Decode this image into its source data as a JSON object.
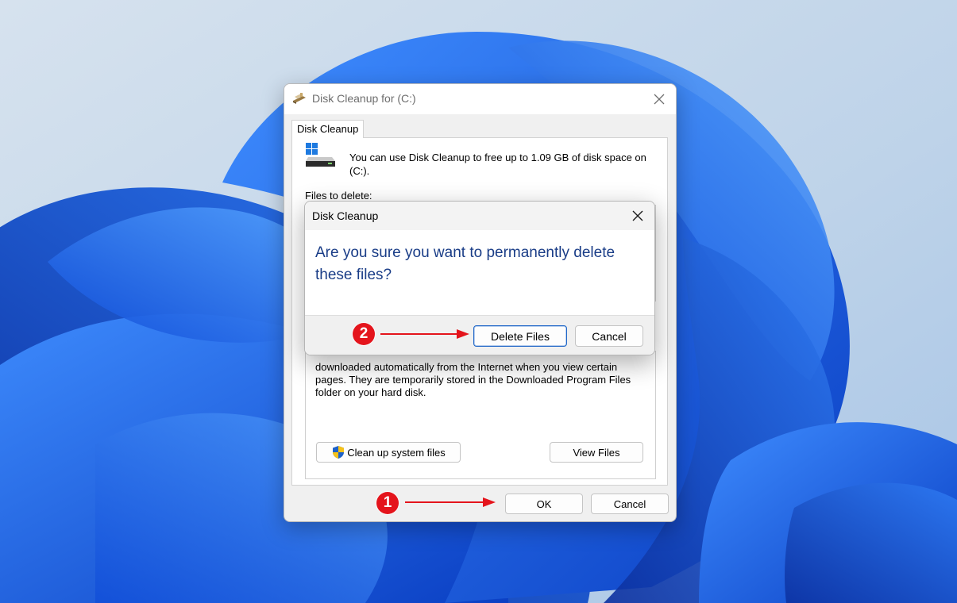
{
  "main_window": {
    "title": "Disk Cleanup for  (C:)",
    "tab_label": "Disk Cleanup",
    "intro_text": "You can use Disk Cleanup to free up to 1.09 GB of disk space on (C:).",
    "files_to_delete_label": "Files to delete:",
    "description_text": "downloaded automatically from the Internet when you view certain pages. They are temporarily stored in the Downloaded Program Files folder on your hard disk.",
    "cleanup_system_label": "Clean up system files",
    "view_files_label": "View Files",
    "ok_label": "OK",
    "cancel_label": "Cancel"
  },
  "confirm_dialog": {
    "title": "Disk Cleanup",
    "message": "Are you sure you want to permanently delete these files?",
    "delete_label": "Delete Files",
    "cancel_label": "Cancel"
  },
  "annotations": {
    "step_1": "1",
    "step_2": "2",
    "color": "#e4141c"
  },
  "icons": {
    "title": "disk-cleanup-icon",
    "close": "close-icon",
    "drive": "drive-icon",
    "shield": "uac-shield-icon"
  },
  "colors": {
    "dialog_message": "#1a3d87",
    "focus_border": "#1f66c7",
    "wallpaper_blue": "#1a5ae6"
  }
}
